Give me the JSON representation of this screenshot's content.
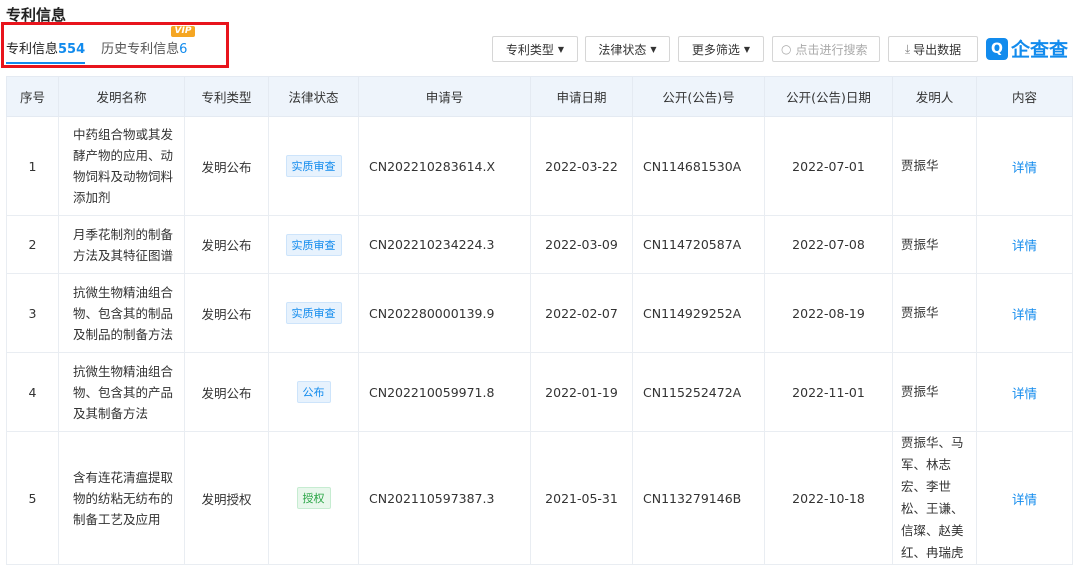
{
  "section_title": "专利信息",
  "tabs": [
    {
      "label": "专利信息",
      "count": "554"
    },
    {
      "label": "历史专利信息",
      "count": "6",
      "badge": "VIP"
    }
  ],
  "toolbar": {
    "type_filter": "专利类型",
    "status_filter": "法律状态",
    "more_filter": "更多筛选",
    "search_placeholder": "点击进行搜索",
    "export": "导出数据",
    "logo_text": "企查查"
  },
  "table": {
    "headers": [
      "序号",
      "发明名称",
      "专利类型",
      "法律状态",
      "申请号",
      "申请日期",
      "公开(公告)号",
      "公开(公告)日期",
      "发明人",
      "内容"
    ],
    "rows": [
      {
        "no": "1",
        "name": "中药组合物或其发酵产物的应用、动物饲料及动物饲料添加剂",
        "type": "发明公布",
        "status": "实质审查",
        "app_no": "CN202210283614.X",
        "app_date": "2022-03-22",
        "pub_no": "CN114681530A",
        "pub_date": "2022-07-01",
        "inventor": "贾振华",
        "action": "详情"
      },
      {
        "no": "2",
        "name": "月季花制剂的制备方法及其特征图谱",
        "type": "发明公布",
        "status": "实质审查",
        "app_no": "CN202210234224.3",
        "app_date": "2022-03-09",
        "pub_no": "CN114720587A",
        "pub_date": "2022-07-08",
        "inventor": "贾振华",
        "action": "详情"
      },
      {
        "no": "3",
        "name": "抗微生物精油组合物、包含其的制品及制品的制备方法",
        "type": "发明公布",
        "status": "实质审查",
        "app_no": "CN202280000139.9",
        "app_date": "2022-02-07",
        "pub_no": "CN114929252A",
        "pub_date": "2022-08-19",
        "inventor": "贾振华",
        "action": "详情"
      },
      {
        "no": "4",
        "name": "抗微生物精油组合物、包含其的产品及其制备方法",
        "type": "发明公布",
        "status": "公布",
        "app_no": "CN202210059971.8",
        "app_date": "2022-01-19",
        "pub_no": "CN115252472A",
        "pub_date": "2022-11-01",
        "inventor": "贾振华",
        "action": "详情"
      },
      {
        "no": "5",
        "name": "含有连花清瘟提取物的纺粘无纺布的制备工艺及应用",
        "type": "发明授权",
        "status": "授权",
        "app_no": "CN202110597387.3",
        "app_date": "2021-05-31",
        "pub_no": "CN113279146B",
        "pub_date": "2022-10-18",
        "inventor": "贾振华、马军、林志宏、李世松、王谦、信璨、赵美红、冉瑞虎",
        "action": "详情"
      }
    ]
  },
  "colors": {
    "accent": "#128bed",
    "highlight_box": "#e8141c",
    "vip": "#f5a623"
  }
}
